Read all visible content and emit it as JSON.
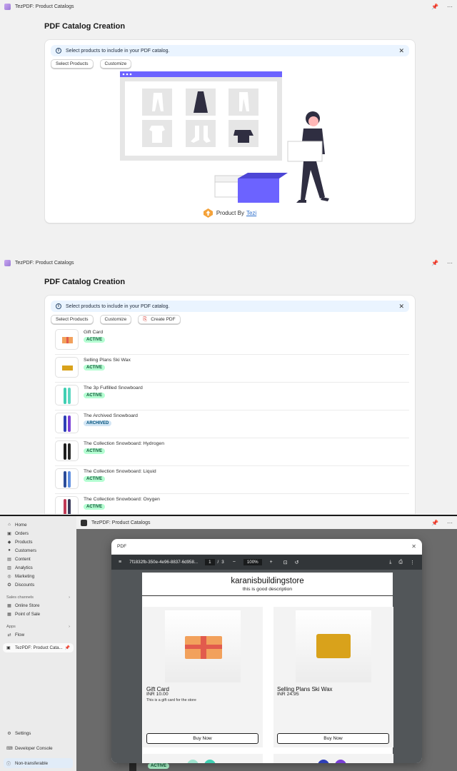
{
  "app": {
    "title": "TezPDF: Product Catalogs",
    "page_title": "PDF Catalog Creation",
    "banner_text": "Select products to include in your PDF catalog.",
    "buttons": {
      "select_products": "Select Products",
      "customize": "Customize",
      "create_pdf": "Create PDF"
    },
    "product_by": "Product By",
    "product_by_brand": "Tezi"
  },
  "products": [
    {
      "name": "Gift Card",
      "status": "ACTIVE",
      "kind": "active"
    },
    {
      "name": "Selling Plans Ski Wax",
      "status": "ACTIVE",
      "kind": "active"
    },
    {
      "name": "The 3p Fulfilled Snowboard",
      "status": "ACTIVE",
      "kind": "active"
    },
    {
      "name": "The Archived Snowboard",
      "status": "ARCHIVED",
      "kind": "archived"
    },
    {
      "name": "The Collection Snowboard: Hydrogen",
      "status": "ACTIVE",
      "kind": "active"
    },
    {
      "name": "The Collection Snowboard: Liquid",
      "status": "ACTIVE",
      "kind": "active"
    },
    {
      "name": "The Collection Snowboard: Oxygen",
      "status": "ACTIVE",
      "kind": "active"
    }
  ],
  "sidebar": {
    "items": [
      {
        "label": "Home",
        "icon": "home-icon"
      },
      {
        "label": "Orders",
        "icon": "orders-icon"
      },
      {
        "label": "Products",
        "icon": "tag-icon"
      },
      {
        "label": "Customers",
        "icon": "person-icon"
      },
      {
        "label": "Content",
        "icon": "content-icon"
      },
      {
        "label": "Analytics",
        "icon": "chart-icon"
      },
      {
        "label": "Marketing",
        "icon": "target-icon"
      },
      {
        "label": "Discounts",
        "icon": "discount-icon"
      }
    ],
    "sales_channels_label": "Sales channels",
    "sales_channels": [
      {
        "label": "Online Store",
        "icon": "store-icon"
      },
      {
        "label": "Point of Sale",
        "icon": "pos-icon"
      }
    ],
    "apps_label": "Apps",
    "apps": [
      {
        "label": "Flow",
        "icon": "flow-icon"
      }
    ],
    "active_app": "TezPDF: Product Cata...",
    "settings": "Settings",
    "developer_console": "Developer Console",
    "non_transferable": "Non-transferable"
  },
  "pdf_modal": {
    "title": "PDF",
    "file_name": "7f1832fb-350e-4e96-8837-6d958...",
    "page_current": "1",
    "page_total": "3",
    "zoom": "100%",
    "store_name": "karanisbuildingstore",
    "store_description": "this is good description",
    "cards": [
      {
        "name": "Gift Card",
        "price": "INR 10.00",
        "description": "This is a gift card for the store",
        "buy_label": "Buy Now"
      },
      {
        "name": "Selling Plans Ski Wax",
        "price": "INR 24.95",
        "description": "",
        "buy_label": "Buy Now"
      }
    ],
    "behind_badge": "ACTIVE"
  },
  "colors": {
    "accent": "#5c5ce0",
    "active_badge_bg": "#b4fed2",
    "archived_badge_bg": "#d3e6f5",
    "banner_bg": "#eaf4ff"
  }
}
